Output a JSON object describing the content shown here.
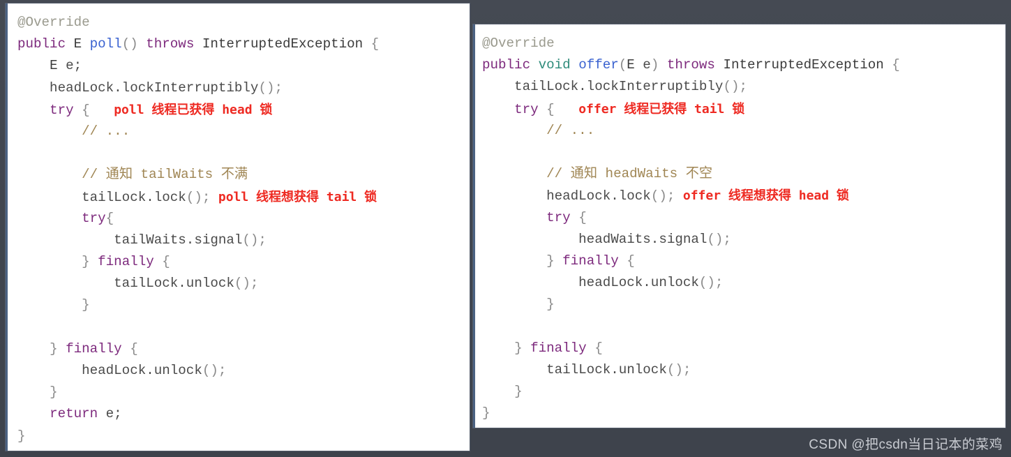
{
  "background": {
    "color": "#41464f"
  },
  "watermark": {
    "text": "CSDN @把csdn当日记本的菜鸡",
    "color": "#c9ccd2"
  },
  "colors": {
    "panel_bg": "#ffffff",
    "keyword": "#7d2a7d",
    "method": "#3a62d0",
    "comment": "#a08654",
    "annotation": "#9a9a8e",
    "note_red": "#ee2a22",
    "plain": "#4a4a4a"
  },
  "panels": [
    {
      "id": "poll-method-panel",
      "title": "poll",
      "lines": [
        [
          {
            "t": "@Override",
            "c": "ann"
          }
        ],
        [
          {
            "t": "public",
            "c": "kw"
          },
          {
            "t": " ",
            "c": "plain"
          },
          {
            "t": "E",
            "c": "type"
          },
          {
            "t": " ",
            "c": "plain"
          },
          {
            "t": "poll",
            "c": "fn"
          },
          {
            "t": "()",
            "c": "punct"
          },
          {
            "t": " ",
            "c": "plain"
          },
          {
            "t": "throws",
            "c": "kw"
          },
          {
            "t": " ",
            "c": "plain"
          },
          {
            "t": "InterruptedException",
            "c": "type"
          },
          {
            "t": " ",
            "c": "plain"
          },
          {
            "t": "{",
            "c": "punct"
          }
        ],
        [
          {
            "t": "    ",
            "c": "plain"
          },
          {
            "t": "E",
            "c": "type"
          },
          {
            "t": " e;",
            "c": "plain"
          }
        ],
        [
          {
            "t": "    headLock.lockInterruptibly",
            "c": "plain"
          },
          {
            "t": "();",
            "c": "punct"
          }
        ],
        [
          {
            "t": "    ",
            "c": "plain"
          },
          {
            "t": "try",
            "c": "kw"
          },
          {
            "t": " ",
            "c": "plain"
          },
          {
            "t": "{",
            "c": "punct"
          },
          {
            "t": "   ",
            "c": "plain"
          },
          {
            "t": "poll 线程已获得 head 锁",
            "c": "note"
          }
        ],
        [
          {
            "t": "        ",
            "c": "plain"
          },
          {
            "t": "// ...",
            "c": "cmt"
          }
        ],
        [
          {
            "t": "",
            "c": "plain"
          }
        ],
        [
          {
            "t": "        ",
            "c": "plain"
          },
          {
            "t": "// 通知 tailWaits 不满",
            "c": "cmt"
          }
        ],
        [
          {
            "t": "        tailLock.lock",
            "c": "plain"
          },
          {
            "t": "();",
            "c": "punct"
          },
          {
            "t": " ",
            "c": "plain"
          },
          {
            "t": "poll 线程想获得 tail 锁",
            "c": "note"
          }
        ],
        [
          {
            "t": "        ",
            "c": "plain"
          },
          {
            "t": "try",
            "c": "kw"
          },
          {
            "t": "{",
            "c": "punct"
          }
        ],
        [
          {
            "t": "            tailWaits.signal",
            "c": "plain"
          },
          {
            "t": "();",
            "c": "punct"
          }
        ],
        [
          {
            "t": "        ",
            "c": "plain"
          },
          {
            "t": "}",
            "c": "punct"
          },
          {
            "t": " ",
            "c": "plain"
          },
          {
            "t": "finally",
            "c": "kw"
          },
          {
            "t": " ",
            "c": "plain"
          },
          {
            "t": "{",
            "c": "punct"
          }
        ],
        [
          {
            "t": "            tailLock.unlock",
            "c": "plain"
          },
          {
            "t": "();",
            "c": "punct"
          }
        ],
        [
          {
            "t": "        ",
            "c": "plain"
          },
          {
            "t": "}",
            "c": "punct"
          }
        ],
        [
          {
            "t": "",
            "c": "plain"
          }
        ],
        [
          {
            "t": "    ",
            "c": "plain"
          },
          {
            "t": "}",
            "c": "punct"
          },
          {
            "t": " ",
            "c": "plain"
          },
          {
            "t": "finally",
            "c": "kw"
          },
          {
            "t": " ",
            "c": "plain"
          },
          {
            "t": "{",
            "c": "punct"
          }
        ],
        [
          {
            "t": "        headLock.unlock",
            "c": "plain"
          },
          {
            "t": "();",
            "c": "punct"
          }
        ],
        [
          {
            "t": "    ",
            "c": "plain"
          },
          {
            "t": "}",
            "c": "punct"
          }
        ],
        [
          {
            "t": "    ",
            "c": "plain"
          },
          {
            "t": "return",
            "c": "kw"
          },
          {
            "t": " e;",
            "c": "plain"
          }
        ],
        [
          {
            "t": "}",
            "c": "punct"
          }
        ]
      ]
    },
    {
      "id": "offer-method-panel",
      "title": "offer",
      "lines": [
        [
          {
            "t": "@Override",
            "c": "ann"
          }
        ],
        [
          {
            "t": "public",
            "c": "kw"
          },
          {
            "t": " ",
            "c": "plain"
          },
          {
            "t": "void",
            "c": "vkw"
          },
          {
            "t": " ",
            "c": "plain"
          },
          {
            "t": "offer",
            "c": "fn"
          },
          {
            "t": "(",
            "c": "punct"
          },
          {
            "t": "E",
            "c": "type"
          },
          {
            "t": " e",
            "c": "plain"
          },
          {
            "t": ")",
            "c": "punct"
          },
          {
            "t": " ",
            "c": "plain"
          },
          {
            "t": "throws",
            "c": "kw"
          },
          {
            "t": " ",
            "c": "plain"
          },
          {
            "t": "InterruptedException",
            "c": "type"
          },
          {
            "t": " ",
            "c": "plain"
          },
          {
            "t": "{",
            "c": "punct"
          }
        ],
        [
          {
            "t": "    tailLock.lockInterruptibly",
            "c": "plain"
          },
          {
            "t": "();",
            "c": "punct"
          }
        ],
        [
          {
            "t": "    ",
            "c": "plain"
          },
          {
            "t": "try",
            "c": "kw"
          },
          {
            "t": " ",
            "c": "plain"
          },
          {
            "t": "{",
            "c": "punct"
          },
          {
            "t": "   ",
            "c": "plain"
          },
          {
            "t": "offer 线程已获得 tail 锁",
            "c": "note"
          }
        ],
        [
          {
            "t": "        ",
            "c": "plain"
          },
          {
            "t": "// ...",
            "c": "cmt"
          }
        ],
        [
          {
            "t": "",
            "c": "plain"
          }
        ],
        [
          {
            "t": "        ",
            "c": "plain"
          },
          {
            "t": "// 通知 headWaits 不空",
            "c": "cmt"
          }
        ],
        [
          {
            "t": "        headLock.lock",
            "c": "plain"
          },
          {
            "t": "();",
            "c": "punct"
          },
          {
            "t": " ",
            "c": "plain"
          },
          {
            "t": "offer 线程想获得 head 锁",
            "c": "note"
          }
        ],
        [
          {
            "t": "        ",
            "c": "plain"
          },
          {
            "t": "try",
            "c": "kw"
          },
          {
            "t": " ",
            "c": "plain"
          },
          {
            "t": "{",
            "c": "punct"
          }
        ],
        [
          {
            "t": "            headWaits.signal",
            "c": "plain"
          },
          {
            "t": "();",
            "c": "punct"
          }
        ],
        [
          {
            "t": "        ",
            "c": "plain"
          },
          {
            "t": "}",
            "c": "punct"
          },
          {
            "t": " ",
            "c": "plain"
          },
          {
            "t": "finally",
            "c": "kw"
          },
          {
            "t": " ",
            "c": "plain"
          },
          {
            "t": "{",
            "c": "punct"
          }
        ],
        [
          {
            "t": "            headLock.unlock",
            "c": "plain"
          },
          {
            "t": "();",
            "c": "punct"
          }
        ],
        [
          {
            "t": "        ",
            "c": "plain"
          },
          {
            "t": "}",
            "c": "punct"
          }
        ],
        [
          {
            "t": "",
            "c": "plain"
          }
        ],
        [
          {
            "t": "    ",
            "c": "plain"
          },
          {
            "t": "}",
            "c": "punct"
          },
          {
            "t": " ",
            "c": "plain"
          },
          {
            "t": "finally",
            "c": "kw"
          },
          {
            "t": " ",
            "c": "plain"
          },
          {
            "t": "{",
            "c": "punct"
          }
        ],
        [
          {
            "t": "        tailLock.unlock",
            "c": "plain"
          },
          {
            "t": "();",
            "c": "punct"
          }
        ],
        [
          {
            "t": "    ",
            "c": "plain"
          },
          {
            "t": "}",
            "c": "punct"
          }
        ],
        [
          {
            "t": "}",
            "c": "punct"
          }
        ]
      ]
    }
  ]
}
